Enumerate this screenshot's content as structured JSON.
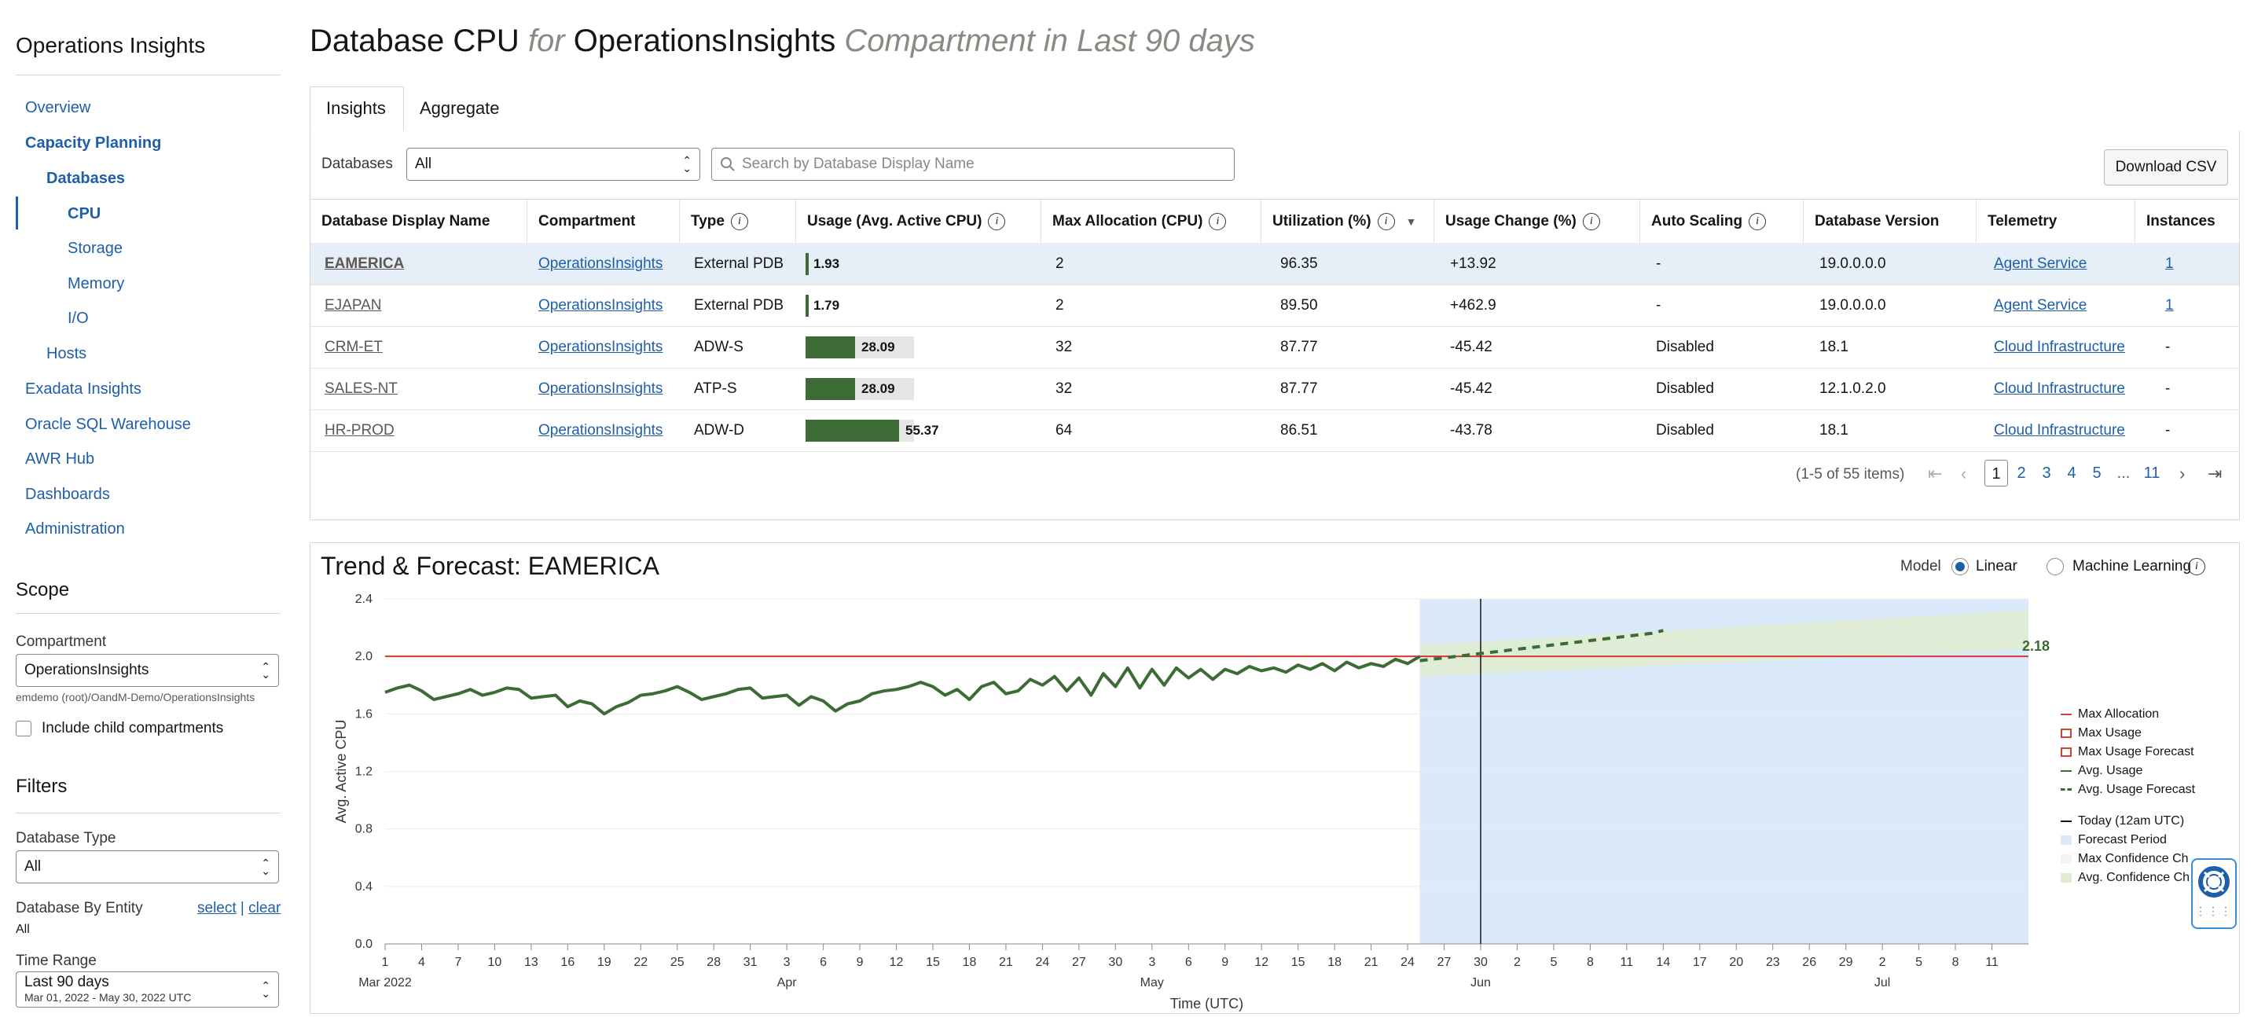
{
  "sidebar": {
    "title": "Operations Insights",
    "nav": [
      {
        "label": "Overview"
      },
      {
        "label": "Capacity Planning"
      },
      {
        "label": "Databases"
      },
      {
        "label": "CPU"
      },
      {
        "label": "Storage"
      },
      {
        "label": "Memory"
      },
      {
        "label": "I/O"
      },
      {
        "label": "Hosts"
      },
      {
        "label": "Exadata Insights"
      },
      {
        "label": "Oracle SQL Warehouse"
      },
      {
        "label": "AWR Hub"
      },
      {
        "label": "Dashboards"
      },
      {
        "label": "Administration"
      }
    ],
    "scope": {
      "heading": "Scope",
      "compartment_label": "Compartment",
      "compartment_value": "OperationsInsights",
      "compartment_path": "emdemo (root)/OandM-Demo/OperationsInsights",
      "include_child_label": "Include child compartments"
    },
    "filters": {
      "heading": "Filters",
      "db_type_label": "Database Type",
      "db_type_value": "All",
      "by_entity_label": "Database By Entity",
      "select_link": "select",
      "separator": "|",
      "clear_link": "clear",
      "by_entity_value": "All",
      "time_range_label": "Time Range",
      "time_range_value": "Last 90 days",
      "time_range_sub": "Mar 01, 2022 - May 30, 2022 UTC"
    }
  },
  "header": {
    "title_1": "Database CPU",
    "title_for": "for",
    "title_2": "OperationsInsights",
    "title_3": "Compartment in Last 90 days"
  },
  "tabs": [
    {
      "label": "Insights"
    },
    {
      "label": "Aggregate"
    }
  ],
  "toolbar": {
    "databases_label": "Databases",
    "databases_value": "All",
    "search_placeholder": "Search by Database Display Name",
    "download_label": "Download CSV"
  },
  "table": {
    "columns": [
      "Database Display Name",
      "Compartment",
      "Type",
      "Usage (Avg. Active CPU)",
      "Max Allocation (CPU)",
      "Utilization (%)",
      "Usage Change (%)",
      "Auto Scaling",
      "Database Version",
      "Telemetry",
      "Instances"
    ],
    "rows": [
      {
        "name": "EAMERICA",
        "compartment": "OperationsInsights",
        "type": "External PDB",
        "usage": "1.93",
        "usage_frac": 0.03,
        "max_alloc": "2",
        "util": "96.35",
        "change": "+13.92",
        "auto": "-",
        "version": "19.0.0.0.0",
        "telemetry": "Agent Service",
        "instances": "1"
      },
      {
        "name": "EJAPAN",
        "compartment": "OperationsInsights",
        "type": "External PDB",
        "usage": "1.79",
        "usage_frac": 0.03,
        "max_alloc": "2",
        "util": "89.50",
        "change": "+462.9",
        "auto": "-",
        "version": "19.0.0.0.0",
        "telemetry": "Agent Service",
        "instances": "1"
      },
      {
        "name": "CRM-ET",
        "compartment": "OperationsInsights",
        "type": "ADW-S",
        "usage": "28.09",
        "usage_frac": 0.46,
        "max_alloc": "32",
        "util": "87.77",
        "change": "-45.42",
        "auto": "Disabled",
        "version": "18.1",
        "telemetry": "Cloud Infrastructure",
        "instances": "-"
      },
      {
        "name": "SALES-NT",
        "compartment": "OperationsInsights",
        "type": "ATP-S",
        "usage": "28.09",
        "usage_frac": 0.46,
        "max_alloc": "32",
        "util": "87.77",
        "change": "-45.42",
        "auto": "Disabled",
        "version": "12.1.0.2.0",
        "telemetry": "Cloud Infrastructure",
        "instances": "-"
      },
      {
        "name": "HR-PROD",
        "compartment": "OperationsInsights",
        "type": "ADW-D",
        "usage": "55.37",
        "usage_frac": 0.86,
        "max_alloc": "64",
        "util": "86.51",
        "change": "-43.78",
        "auto": "Disabled",
        "version": "18.1",
        "telemetry": "Cloud Infrastructure",
        "instances": "-"
      }
    ],
    "pagination": {
      "summary": "(1-5 of 55 items)",
      "pages": [
        "1",
        "2",
        "3",
        "4",
        "5",
        "...",
        "11"
      ],
      "current": "1"
    }
  },
  "trend": {
    "title": "Trend & Forecast: EAMERICA",
    "model_label": "Model",
    "model_linear": "Linear",
    "model_ml": "Machine Learning",
    "model_selected": "Linear",
    "legend": [
      {
        "label": "Max Allocation",
        "color": "#c74634"
      },
      {
        "label": "Max Usage",
        "color": "#c74634"
      },
      {
        "label": "Max Usage Forecast",
        "color": "#c74634"
      },
      {
        "label": "Avg. Usage",
        "color": "#3d6b35"
      },
      {
        "label": "Avg. Usage Forecast",
        "color": "#3d6b35"
      },
      {
        "label": "Today (12am UTC)",
        "color": "#161513"
      },
      {
        "label": "Forecast Period",
        "color": "#dbeafa"
      },
      {
        "label": "Max Confidence Ch",
        "color": "#f4f4f4"
      },
      {
        "label": "Avg. Confidence Ch",
        "color": "#dfeccf"
      }
    ]
  },
  "chart_data": {
    "type": "line",
    "title": "Trend & Forecast: EAMERICA",
    "xlabel": "Time (UTC)",
    "ylabel": "Avg. Active CPU",
    "ylim": [
      0,
      2.4
    ],
    "yticks": [
      "0.0",
      "0.4",
      "0.8",
      "1.2",
      "1.6",
      "2.0",
      "2.4"
    ],
    "x_start": "2022-03-01",
    "x_end": "2022-07-14",
    "xtick_labels": [
      "1",
      "4",
      "7",
      "10",
      "13",
      "16",
      "19",
      "22",
      "25",
      "28",
      "31",
      "3",
      "6",
      "9",
      "12",
      "15",
      "18",
      "21",
      "24",
      "27",
      "30",
      "3",
      "6",
      "9",
      "12",
      "15",
      "18",
      "21",
      "24",
      "27",
      "30",
      "2",
      "5",
      "8",
      "11",
      "14",
      "17",
      "20",
      "23",
      "26",
      "29",
      "2",
      "5",
      "8",
      "11"
    ],
    "month_labels": [
      {
        "tick": "1",
        "month": "Mar 2022"
      },
      {
        "tick": "3",
        "month": "Apr"
      },
      {
        "tick": "3",
        "month": "May"
      },
      {
        "tick": "30",
        "month": "Jun"
      },
      {
        "tick": "2",
        "month": "Jul"
      }
    ],
    "max_allocation": 2.0,
    "today": "2022-05-30",
    "forecast_period": [
      "2022-05-25",
      "2022-07-14"
    ],
    "series": [
      {
        "name": "Avg. Usage",
        "start": "2022-03-01",
        "values": [
          1.75,
          1.78,
          1.8,
          1.76,
          1.7,
          1.72,
          1.74,
          1.77,
          1.73,
          1.75,
          1.78,
          1.77,
          1.71,
          1.72,
          1.73,
          1.65,
          1.69,
          1.67,
          1.6,
          1.65,
          1.68,
          1.73,
          1.74,
          1.76,
          1.79,
          1.75,
          1.7,
          1.72,
          1.74,
          1.77,
          1.78,
          1.71,
          1.72,
          1.73,
          1.66,
          1.72,
          1.69,
          1.62,
          1.67,
          1.69,
          1.74,
          1.76,
          1.77,
          1.79,
          1.82,
          1.79,
          1.73,
          1.77,
          1.7,
          1.79,
          1.82,
          1.74,
          1.76,
          1.84,
          1.8,
          1.86,
          1.76,
          1.85,
          1.73,
          1.88,
          1.79,
          1.92,
          1.78,
          1.91,
          1.8,
          1.92,
          1.85,
          1.91,
          1.84,
          1.91,
          1.88,
          1.93,
          1.9,
          1.92,
          1.89,
          1.94,
          1.91,
          1.95,
          1.9,
          1.96,
          1.92,
          1.95,
          1.93,
          1.98,
          1.95,
          2.0
        ]
      },
      {
        "name": "Avg. Usage Forecast",
        "start": "2022-05-25",
        "values": [
          1.97,
          1.98,
          1.99,
          2.0,
          2.01,
          2.02,
          2.03,
          2.04,
          2.05,
          2.06,
          2.07,
          2.08,
          2.09,
          2.1,
          2.11,
          2.12,
          2.13,
          2.14,
          2.15,
          2.16,
          2.18
        ]
      }
    ],
    "confidence_band": {
      "start_low": 1.86,
      "start_high": 2.08,
      "end_low": 2.05,
      "end_high": 2.32
    },
    "end_label": "2.18"
  }
}
